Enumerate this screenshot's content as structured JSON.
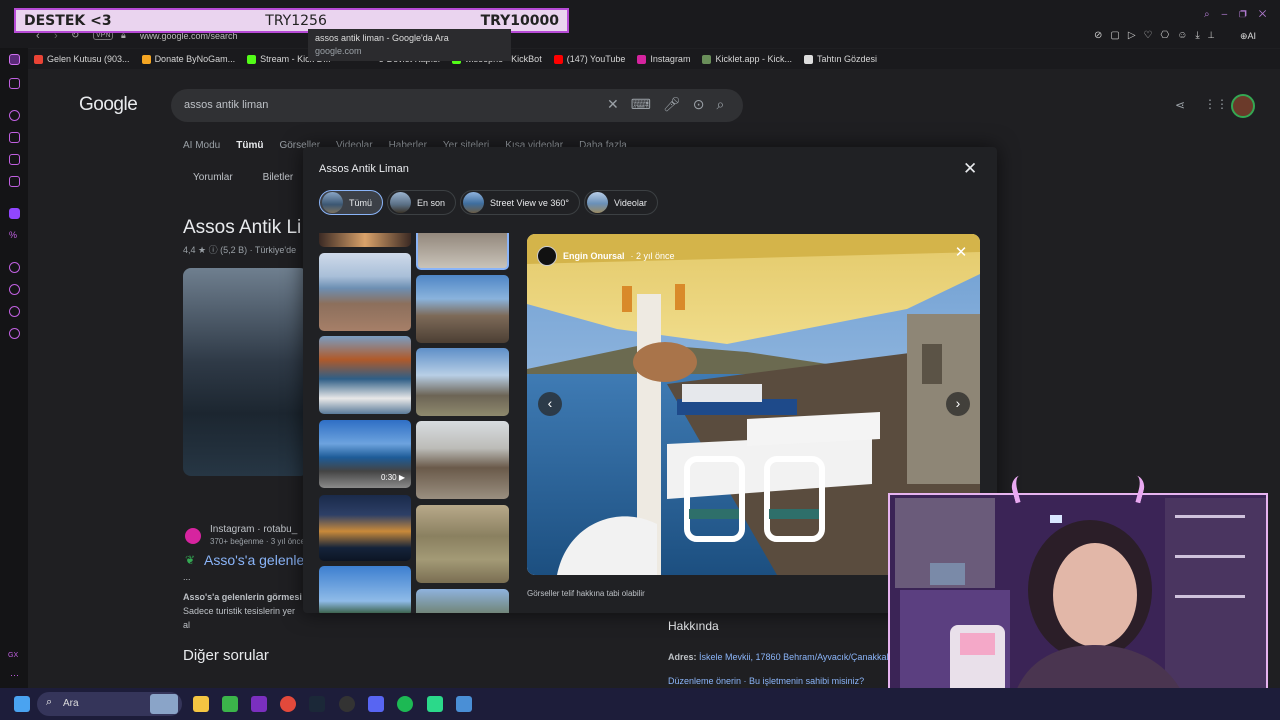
{
  "overlay": {
    "label": "DESTEK <3",
    "current": "TRY1256",
    "goal": "TRY10000"
  },
  "browser": {
    "url": "www.google.com/search",
    "vpn_badge": "VPN",
    "tooltip_title": "assos antik liman - Google'da Ara",
    "tooltip_sub": "google.com",
    "bookmarks": [
      "Gelen Kutusu (903...",
      "Donate ByNoGam...",
      "Stream - Kick D...",
      "e-Devlet Kapısı",
      "wiseephe - KickBot",
      "(147) YouTube",
      "Instagram",
      "Kicklet.app - Kick...",
      "Tahtın Gözdesi"
    ]
  },
  "google": {
    "logo": "Google",
    "query": "assos antik liman",
    "tabs": [
      "AI Modu",
      "Tümü",
      "Görseller",
      "Videolar",
      "Haberler",
      "Yer siteleri",
      "Kısa videolar",
      "Daha fazla"
    ],
    "subtabs": [
      "Yorumlar",
      "Biletler"
    ],
    "place_title": "Assos Antik Li",
    "rating": "4,4 ★ ⓘ (5,2 B) · Türkiye'de",
    "insta_source": "Instagram · rotabu_",
    "insta_meta": "370+ beğenme · 3 yıl önce",
    "insta_title": "Asso's'a gelenleri",
    "insta_ellipsis": "...",
    "insta_desc1": "Asso's'a gelenlerin görmesi",
    "insta_desc2": "Sadece turistik tesislerin yer al",
    "other_questions": "Diğer sorular",
    "about": "Hakkında",
    "address_label": "Adres:",
    "address_value": "İskele Mevkii, 17860 Behram/Ayvacık/Çanakkale",
    "edit_links": "Düzenleme önerin · Bu işletmenin sahibi misiniz?"
  },
  "modal": {
    "title": "Assos Antik Liman",
    "chips": [
      "Tümü",
      "En son",
      "Street View ve 360°",
      "Videolar"
    ],
    "author": "Engin Onursal",
    "time": "· 2 yıl önce",
    "video_duration": "0:30",
    "copyright": "Görseller telif hakkına tabi olabilir"
  },
  "taskbar": {
    "search_label": "Ara"
  }
}
